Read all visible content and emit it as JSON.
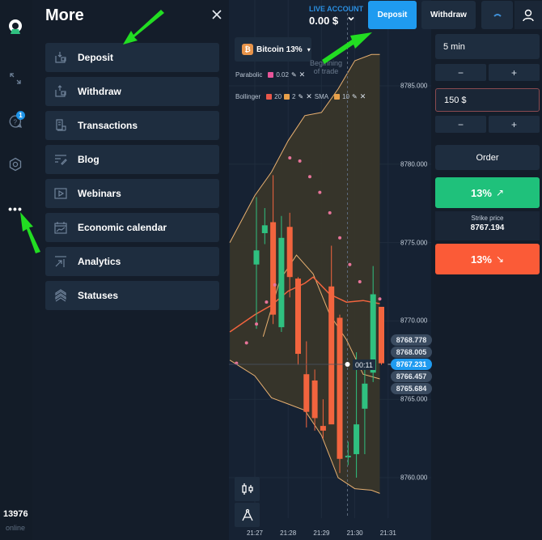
{
  "app": {
    "online_count": "13976",
    "online_label": "online",
    "notification_count": "1",
    "more_icon": "ellipsis-icon"
  },
  "rail": {
    "icons": [
      "logo-icon",
      "fullscreen-icon",
      "help-icon",
      "settings-icon",
      "more-dots-icon"
    ]
  },
  "more_panel": {
    "title": "More",
    "close_icon": "close-icon",
    "items": [
      {
        "label": "Deposit",
        "icon": "deposit-icon"
      },
      {
        "label": "Withdraw",
        "icon": "withdraw-icon"
      },
      {
        "label": "Transactions",
        "icon": "receipt-icon"
      },
      {
        "label": "Blog",
        "icon": "blog-icon"
      },
      {
        "label": "Webinars",
        "icon": "video-icon"
      },
      {
        "label": "Economic calendar",
        "icon": "calendar-chart-icon"
      },
      {
        "label": "Analytics",
        "icon": "analytics-icon"
      },
      {
        "label": "Statuses",
        "icon": "statuses-icon"
      }
    ]
  },
  "header": {
    "account_label": "LIVE ACCOUNT",
    "balance": "0.00 $",
    "caret": "⌄",
    "deposit_label": "Deposit",
    "withdraw_label": "Withdraw"
  },
  "asset": {
    "name_label": "Bitcoin 13%",
    "caret": "▾",
    "icon_glyph": "₿"
  },
  "indicators": {
    "parabolic": {
      "name": "Parabolic",
      "value": "0.02",
      "color": "#e8559a"
    },
    "bollinger": {
      "name": "Bollinger",
      "period": "20",
      "period_color": "#e8574a",
      "dev": "2",
      "dev_color": "#e8a04a"
    },
    "sma": {
      "name": "SMA",
      "period": "10",
      "color": "#e8a04a"
    },
    "edit_glyph": "✎",
    "remove_glyph": "✕"
  },
  "trade_marker": {
    "label_line1": "Beginning",
    "label_line2": "of trade",
    "timer": "00:11"
  },
  "price_labels": [
    {
      "value": "8768.778",
      "current": false
    },
    {
      "value": "8768.005",
      "current": false
    },
    {
      "value": "8767.231",
      "current": true
    },
    {
      "value": "8766.457",
      "current": false
    },
    {
      "value": "8765.684",
      "current": false
    }
  ],
  "right_panel": {
    "time_value": "5 min",
    "time_minus": "−",
    "time_plus": "+",
    "amount_value": "150 $",
    "amount_minus": "−",
    "amount_plus": "+",
    "order_label": "Order",
    "up_label": "13%",
    "up_arrow": "↗",
    "strike_label": "Strike price",
    "strike_value": "8767.194",
    "down_label": "13%",
    "down_arrow": "↘"
  },
  "colors": {
    "accent_blue": "#1f9bf0",
    "up_green": "#1fc17b",
    "down_red": "#fb5b37",
    "candle_up": "#2fc080",
    "candle_down": "#f2643e",
    "bollinger_band": "#e8b070",
    "sma_line": "#f2643e",
    "psar_dot": "#e8749a"
  },
  "chart_data": {
    "type": "candlestick",
    "title": "Bitcoin 13%",
    "xlabel": "",
    "ylabel": "",
    "x_ticks": [
      "21:27",
      "21:28",
      "21:29",
      "21:30",
      "21:31"
    ],
    "y_ticks": [
      "8785.000",
      "8780.000",
      "8775.000",
      "8770.000",
      "8765.000",
      "8760.000"
    ],
    "ylim": [
      8758.5,
      8790
    ],
    "time_domain_minutes": [
      -0.75,
      4.2
    ],
    "begin_trade_minute": 2.78,
    "current_price": 8767.231,
    "candles": [
      {
        "t": 0.0,
        "open": 8773.6,
        "high": 8777.9,
        "low": 8769.5,
        "close": 8774.5
      },
      {
        "t": 0.25,
        "open": 8775.6,
        "high": 8777.2,
        "low": 8774.9,
        "close": 8776.1
      },
      {
        "t": 0.5,
        "open": 8776.3,
        "high": 8779.3,
        "low": 8769.8,
        "close": 8770.4
      },
      {
        "t": 0.75,
        "open": 8769.6,
        "high": 8776.7,
        "low": 8769.3,
        "close": 8775.3
      },
      {
        "t": 1.0,
        "open": 8776.0,
        "high": 8776.9,
        "low": 8771.5,
        "close": 8772.8
      },
      {
        "t": 1.25,
        "open": 8772.7,
        "high": 8772.8,
        "low": 8767.2,
        "close": 8767.9
      },
      {
        "t": 1.5,
        "open": 8766.6,
        "high": 8768.7,
        "low": 8763.2,
        "close": 8764.2
      },
      {
        "t": 1.75,
        "open": 8766.2,
        "high": 8766.9,
        "low": 8763.0,
        "close": 8763.8
      },
      {
        "t": 2.0,
        "open": 8763.3,
        "high": 8765.0,
        "low": 8762.5,
        "close": 8763.0
      },
      {
        "t": 2.25,
        "open": 8772.2,
        "high": 8774.8,
        "low": 8763.5,
        "close": 8763.4
      },
      {
        "t": 2.5,
        "open": 8770.2,
        "high": 8770.4,
        "low": 8760.3,
        "close": 8761.2
      },
      {
        "t": 2.75,
        "open": 8761.3,
        "high": 8762.3,
        "low": 8760.8,
        "close": 8761.4
      },
      {
        "t": 3.0,
        "open": 8761.5,
        "high": 8768.0,
        "low": 8760.0,
        "close": 8763.4
      },
      {
        "t": 3.25,
        "open": 8764.4,
        "high": 8767.4,
        "low": 8761.5,
        "close": 8766.0
      },
      {
        "t": 3.5,
        "open": 8766.7,
        "high": 8773.5,
        "low": 8766.1,
        "close": 8771.7
      },
      {
        "t": 3.75,
        "open": 8770.9,
        "high": 8770.9,
        "low": 8767.2,
        "close": 8767.3
      }
    ],
    "bollinger_upper": [
      [
        -0.75,
        8775.0
      ],
      [
        0.0,
        8778.0
      ],
      [
        0.5,
        8779.5
      ],
      [
        1.0,
        8781.5
      ],
      [
        1.5,
        8783.1
      ],
      [
        2.0,
        8783.3
      ],
      [
        2.5,
        8784.8
      ],
      [
        3.0,
        8786.6
      ],
      [
        3.5,
        8787.0
      ],
      [
        3.75,
        8787.0
      ]
    ],
    "bollinger_lower": [
      [
        -0.75,
        8767.5
      ],
      [
        0.0,
        8766.5
      ],
      [
        0.5,
        8765.1
      ],
      [
        1.0,
        8764.7
      ],
      [
        1.5,
        8764.3
      ],
      [
        2.0,
        8762.7
      ],
      [
        2.5,
        8760.0
      ],
      [
        3.0,
        8759.3
      ],
      [
        3.5,
        8759.2
      ],
      [
        3.75,
        8759.0
      ]
    ],
    "bollinger_mid": [
      [
        0.25,
        8769.0
      ],
      [
        0.75,
        8772.6
      ],
      [
        1.25,
        8774.2
      ],
      [
        1.75,
        8773.0
      ],
      [
        2.25,
        8770.4
      ],
      [
        2.75,
        8768.8
      ],
      [
        3.25,
        8766.6
      ],
      [
        3.75,
        8766.3
      ]
    ],
    "sma": [
      [
        -0.75,
        8769.3
      ],
      [
        0.0,
        8770.4
      ],
      [
        0.5,
        8771.0
      ],
      [
        1.0,
        8771.9
      ],
      [
        1.5,
        8772.4
      ],
      [
        1.75,
        8772.8
      ],
      [
        2.25,
        8771.7
      ],
      [
        2.75,
        8771.2
      ],
      [
        3.25,
        8771.3
      ],
      [
        3.75,
        8771.1
      ]
    ],
    "parabolic_sar": [
      [
        1.05,
        8780.4
      ],
      [
        1.35,
        8780.2
      ],
      [
        1.65,
        8779.2
      ],
      [
        1.95,
        8778.2
      ],
      [
        2.25,
        8776.9
      ],
      [
        2.55,
        8775.3
      ],
      [
        2.85,
        8773.6
      ],
      [
        3.15,
        8772.5
      ],
      [
        3.75,
        8771.4
      ],
      [
        0.6,
        8772.3
      ],
      [
        0.35,
        8771.2
      ],
      [
        0.05,
        8769.8
      ],
      [
        -0.25,
        8768.6
      ],
      [
        -0.55,
        8767.3
      ]
    ]
  }
}
